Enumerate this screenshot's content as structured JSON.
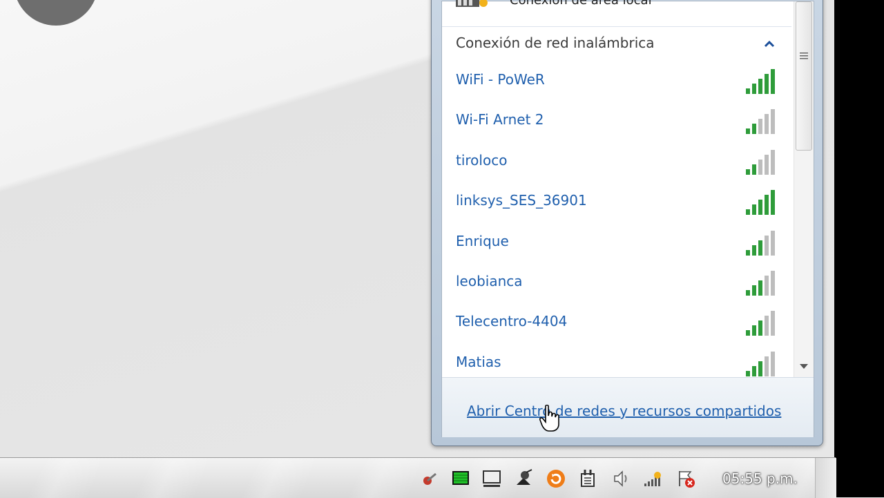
{
  "flyout": {
    "top_item_label": "Conexión de área local",
    "section_title": "Conexión de red inalámbrica",
    "networks": [
      {
        "name": "WiFi - PoWeR",
        "signal": 5
      },
      {
        "name": "Wi-Fi Arnet 2",
        "signal": 2
      },
      {
        "name": "tiroloco",
        "signal": 2
      },
      {
        "name": "linksys_SES_36901",
        "signal": 5
      },
      {
        "name": "Enrique",
        "signal": 3
      },
      {
        "name": "leobianca",
        "signal": 3
      },
      {
        "name": "Telecentro-4404",
        "signal": 3
      },
      {
        "name": "Matias",
        "signal": 3
      }
    ],
    "footer_link": "Abrir Centro de redes y recursos compartidos"
  },
  "taskbar": {
    "clock": "05:55 p.m.",
    "tray_icons": [
      "app-icon",
      "monitor-green-icon",
      "display-icon",
      "satellite-icon",
      "refresh-orange-icon",
      "power-plug-icon",
      "volume-icon",
      "network-signal-icon",
      "action-center-icon"
    ]
  },
  "colors": {
    "link": "#1f5fad",
    "signal_on": "#2e9c3a",
    "signal_off": "#bdbdbd"
  }
}
